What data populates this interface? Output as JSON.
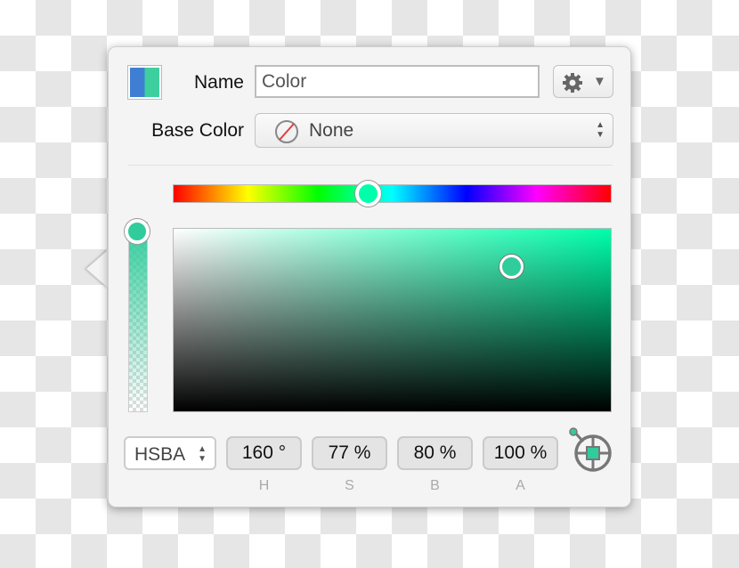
{
  "name_label": "Name",
  "name_value": "Color",
  "base_color_label": "Base Color",
  "base_color_value": "None",
  "mode": "HSBA",
  "fields": [
    {
      "value": "160 °",
      "label": "H"
    },
    {
      "value": "77 %",
      "label": "S"
    },
    {
      "value": "80 %",
      "label": "B"
    },
    {
      "value": "100 %",
      "label": "A"
    }
  ],
  "hue_degrees": 160,
  "saturation": 0.77,
  "brightness": 0.8,
  "alpha": 1.0,
  "colors": {
    "current": "#30cc9b",
    "previous": "#3f7fd3",
    "hue_color": "#00ffaa"
  }
}
